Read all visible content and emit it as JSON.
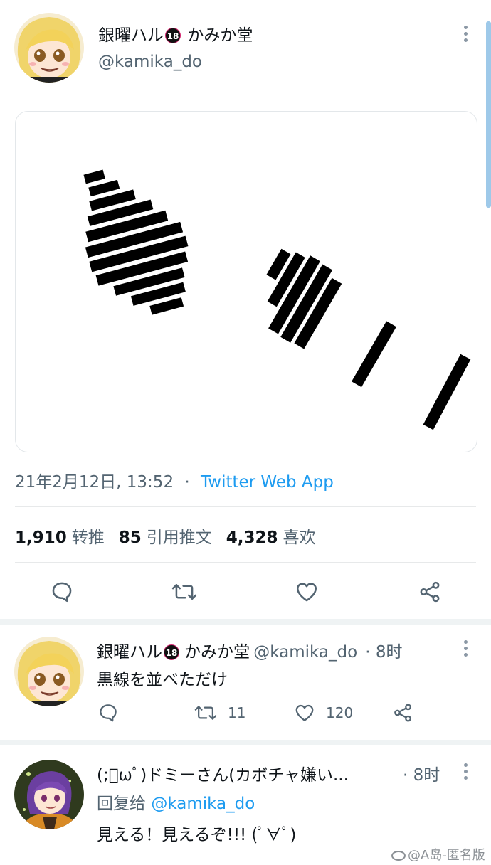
{
  "main_tweet": {
    "author_name": "銀曜ハル",
    "badge": "18",
    "author_name_suffix": "かみか堂",
    "handle": "@kamika_do",
    "timestamp": "21年2月12日, 13:52",
    "separator": "·",
    "source": "Twitter Web App",
    "stats": {
      "retweets_count": "1,910",
      "retweets_label": "转推",
      "quotes_count": "85",
      "quotes_label": "引用推文",
      "likes_count": "4,328",
      "likes_label": "喜欢"
    },
    "icons": [
      "reply-icon",
      "retweet-icon",
      "like-icon",
      "share-icon"
    ]
  },
  "replies": [
    {
      "author_name": "銀曜ハル",
      "badge": "18",
      "author_name_suffix": "かみか堂",
      "handle": "@kamika_do",
      "time": "· 8时",
      "text": "黒線を並べただけ",
      "retweet_count": "11",
      "like_count": "120"
    },
    {
      "author_name": "(;ﾟωﾟ)ドミーさん(カボチャ嫌い...",
      "time": "· 8时",
      "reply_to_label": "回复给",
      "reply_to_handle": "@kamika_do",
      "text": "見える！見えるぞ!!! (ﾟ∀ﾟ)"
    }
  ],
  "watermark": "@A岛-匿名版",
  "colors": {
    "link": "#1d9bf0",
    "secondary_text": "#536471",
    "primary_text": "#0f1419",
    "divider": "#e7e9ea",
    "scrollbar": "#9ec9e9"
  }
}
